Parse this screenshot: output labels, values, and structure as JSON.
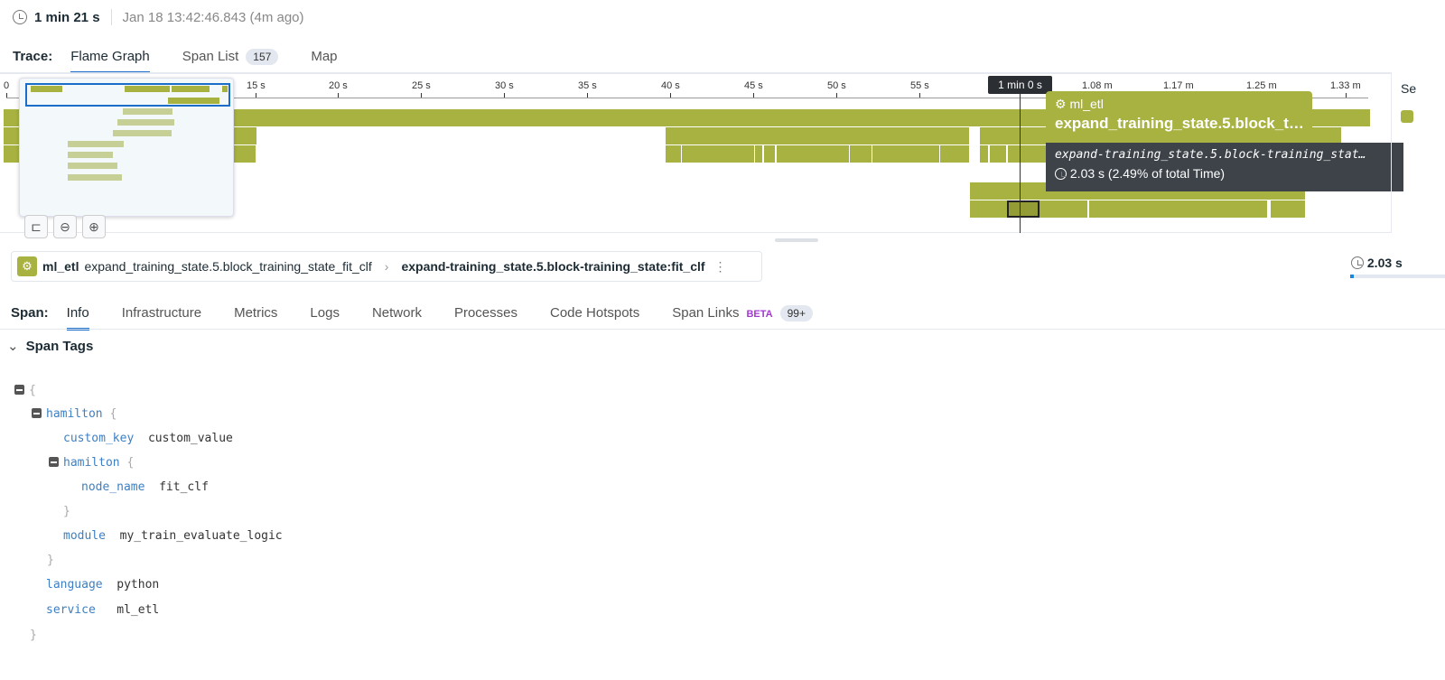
{
  "header": {
    "duration": "1 min 21 s",
    "timestamp": "Jan 18 13:42:46.843 (4m ago)"
  },
  "trace_tabs": {
    "label": "Trace:",
    "tabs": [
      {
        "label": "Flame Graph"
      },
      {
        "label": "Span List",
        "badge": "157"
      },
      {
        "label": "Map"
      }
    ]
  },
  "flame": {
    "ticks": [
      "0",
      "15 s",
      "20 s",
      "25 s",
      "30 s",
      "35 s",
      "40 s",
      "45 s",
      "50 s",
      "55 s",
      "1.08 m",
      "1.17 m",
      "1.25 m",
      "1.33 m"
    ],
    "cursor": "1 min 0 s",
    "bar_color": "#a8b240",
    "side_header": "Se"
  },
  "tooltip": {
    "service": "ml_etl",
    "name": "expand_training_state.5.block_t…",
    "resource": "expand-training_state.5.block-training_stat…",
    "duration": "2.03 s (2.49% of total Time)"
  },
  "breadcrumb": {
    "service": "ml_etl",
    "operation": "expand_training_state.5.block_training_state_fit_clf",
    "resource": "expand-training_state.5.block-training_state:fit_clf"
  },
  "span_duration": "2.03 s",
  "span_duration_fraction": 0.025,
  "span_tabs": {
    "label": "Span:",
    "tabs": [
      {
        "label": "Info"
      },
      {
        "label": "Infrastructure"
      },
      {
        "label": "Metrics"
      },
      {
        "label": "Logs"
      },
      {
        "label": "Network"
      },
      {
        "label": "Processes"
      },
      {
        "label": "Code Hotspots"
      },
      {
        "label": "Span Links",
        "beta": "BETA",
        "badge": "99+"
      }
    ]
  },
  "span_tags": {
    "title": "Span Tags",
    "lines": {
      "open": "{",
      "close": "}",
      "hamilton_key": "hamilton",
      "brace": "{",
      "custom_key": "custom_key",
      "custom_value": "custom_value",
      "inner_key": "hamilton",
      "node_name_key": "node_name",
      "node_name_value": "fit_clf",
      "module_key": "module",
      "module_value": "my_train_evaluate_logic",
      "language_key": "language",
      "language_value": "python",
      "service_key": "service",
      "service_value": "ml_etl"
    }
  }
}
